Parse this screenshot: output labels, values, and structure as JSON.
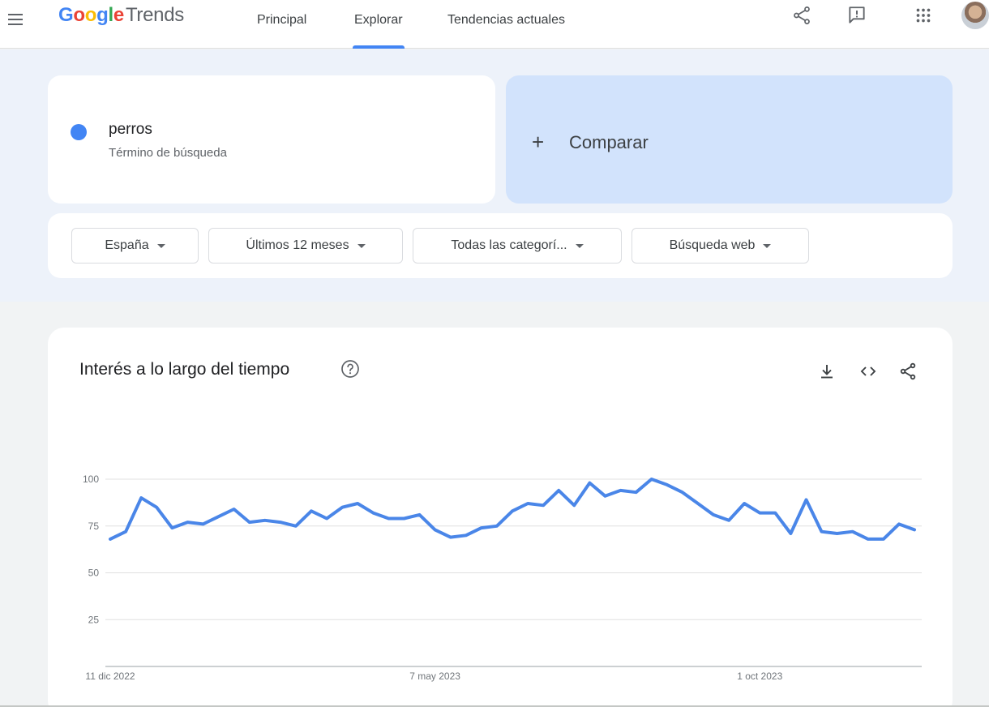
{
  "header": {
    "logo_google": "Google",
    "logo_trends": "Trends",
    "tabs": [
      {
        "label": "Principal"
      },
      {
        "label": "Explorar"
      },
      {
        "label": "Tendencias actuales"
      }
    ],
    "active_tab": "Explorar",
    "icons": [
      "menu-icon",
      "share-icon",
      "feedback-icon",
      "apps-icon",
      "avatar"
    ]
  },
  "search": {
    "term": "perros",
    "term_type": "Término de búsqueda",
    "term_color": "#4285f4",
    "compare_label": "Comparar",
    "compare_color": "#d2e3fc"
  },
  "filters": [
    {
      "label": "España"
    },
    {
      "label": "Últimos 12 meses"
    },
    {
      "label": "Todas las categorí..."
    },
    {
      "label": "Búsqueda web"
    }
  ],
  "chart_card": {
    "title": "Interés a lo largo del tiempo",
    "icons": [
      "help-icon",
      "download-icon",
      "embed-icon",
      "share-icon"
    ]
  },
  "chart_data": {
    "type": "line",
    "title": "Interés a lo largo del tiempo",
    "xlabel": "",
    "ylabel": "",
    "ylim": [
      0,
      100
    ],
    "yticks": [
      25,
      50,
      75,
      100
    ],
    "x_tick_labels": [
      "11 dic 2022",
      "7 may 2023",
      "1 oct 2023"
    ],
    "x_tick_indices": [
      0,
      21,
      42
    ],
    "grid": true,
    "legend": "none",
    "series": [
      {
        "color": "#4a86e8",
        "values": [
          68,
          72,
          90,
          85,
          74,
          77,
          76,
          80,
          84,
          77,
          78,
          77,
          75,
          83,
          79,
          85,
          87,
          82,
          79,
          79,
          81,
          73,
          69,
          70,
          74,
          75,
          83,
          87,
          86,
          94,
          86,
          98,
          91,
          94,
          93,
          100,
          97,
          93,
          87,
          81,
          78,
          87,
          82,
          82,
          71,
          89,
          72,
          71,
          72,
          68,
          68,
          76,
          73
        ]
      }
    ]
  }
}
